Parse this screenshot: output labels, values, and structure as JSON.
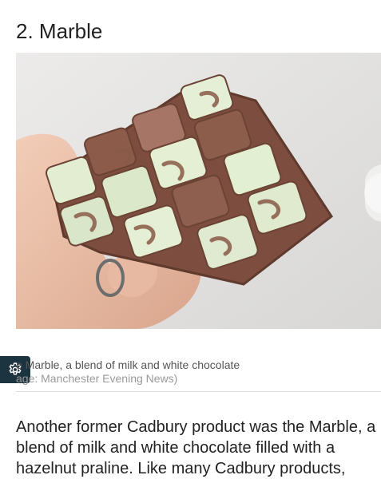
{
  "article": {
    "section_heading": "2. Marble",
    "image": {
      "alt": "Marble chocolate bar held in a hand"
    },
    "caption": {
      "text": "e Marble, a blend of milk and white chocolate",
      "credit": "age: Manchester Evening News)"
    },
    "body": "Another former Cadbury product was the Marble, a blend of milk and white chocolate filled with a hazelnut praline. Like many Cadbury products,"
  },
  "controls": {
    "settings_icon": "gear-icon",
    "next_icon": "chevron-right-icon"
  },
  "colors": {
    "settings_bg": "#1c3340",
    "milk_chocolate": "#8a5a48",
    "white_chocolate": "#e6f0d6"
  }
}
